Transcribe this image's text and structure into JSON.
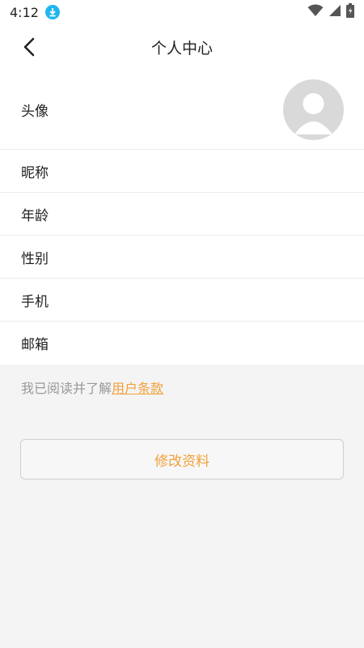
{
  "status_bar": {
    "time": "4:12",
    "icons": [
      "download-icon",
      "wifi-icon",
      "signal-icon",
      "battery-icon"
    ]
  },
  "header": {
    "title": "个人中心",
    "back_icon": "chevron-left-icon"
  },
  "profile_rows": [
    {
      "label": "头像"
    },
    {
      "label": "昵称"
    },
    {
      "label": "年龄"
    },
    {
      "label": "性别"
    },
    {
      "label": "手机"
    },
    {
      "label": "邮箱"
    }
  ],
  "terms": {
    "prefix": "我已阅读并了解",
    "link_label": "用户条款"
  },
  "edit_button": {
    "label": "修改资料"
  },
  "colors": {
    "accent": "#f2a03a",
    "download_badge": "#1fb6f0",
    "background": "#f4f4f4"
  }
}
